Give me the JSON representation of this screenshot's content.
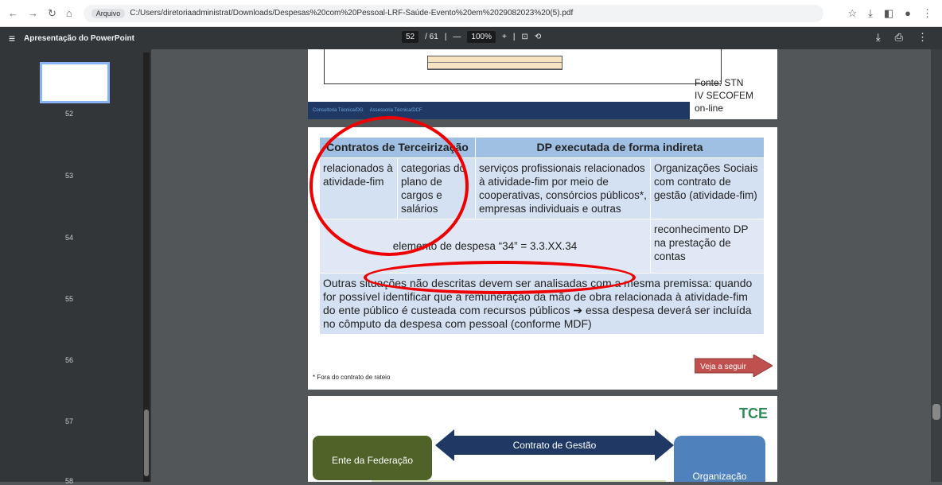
{
  "browser": {
    "origin_label": "Arquivo",
    "url": "C:/Users/diretoriaadministrat/Downloads/Despesas%20com%20Pessoal-LRF-Saúde-Evento%20em%2029082023%20(5).pdf"
  },
  "pdf": {
    "title": "Apresentação do PowerPoint",
    "page_current": "52",
    "page_total": "/ 61",
    "zoom": "100%"
  },
  "sidebar": {
    "pages": [
      "52",
      "53",
      "54",
      "55",
      "56",
      "57",
      "58"
    ]
  },
  "slide1": {
    "source_lines": [
      "Fonte: STN",
      "IV SECOFEM",
      "on-line"
    ],
    "footer_left": "Consultoria Técnica/DG",
    "footer_right": "Assessoria Técnica/DCF"
  },
  "slide2": {
    "header_left": "Contratos de Terceirização",
    "header_right": "DP executada de forma indireta",
    "cell_a": "relacionados à atividade-fim",
    "cell_b": "categorias do plano de cargos e salários",
    "cell_c": "serviços profissionais relacionados à atividade-fim por meio de cooperativas, consórcios públicos*, empresas individuais e outras",
    "cell_d": "Organizações Sociais com contrato de gestão (atividade-fim)",
    "elemento": "elemento de despesa “34” = 3.3.XX.34",
    "reconhecimento": "reconhecimento DP na prestação de contas",
    "veja": "Veja a seguir",
    "outras": "Outras situações não descritas devem ser analisadas com a mesma premissa: quando for possível identificar que a remuneração da mão de obra relacionada à atividade-fim do ente público é custeada com recursos públicos ➔ essa despesa deverá ser incluída no cômputo da despesa com pessoal (conforme MDF)",
    "note": "* Fora do contrato de rateio"
  },
  "slide3": {
    "ente": "Ente da Federação",
    "contrato": "Contrato de Gestão",
    "org": "Organização",
    "logo": "TCE"
  }
}
